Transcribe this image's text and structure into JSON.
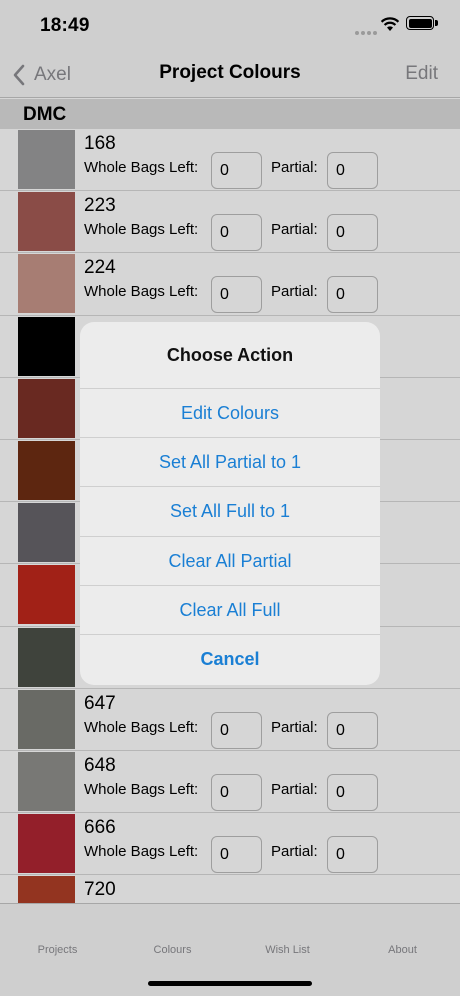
{
  "status": {
    "time": "18:49"
  },
  "nav": {
    "back_label": "Axel",
    "title": "Project Colours",
    "edit_label": "Edit"
  },
  "section": {
    "title": "DMC"
  },
  "labels": {
    "whole": "Whole Bags Left:",
    "partial": "Partial:"
  },
  "rows": [
    {
      "code": "168",
      "color": "#9c9c9e",
      "whole": "0",
      "partial": "0"
    },
    {
      "code": "223",
      "color": "#a55b55",
      "whole": "0",
      "partial": "0"
    },
    {
      "code": "224",
      "color": "#c8968a",
      "whole": "0",
      "partial": "0"
    },
    {
      "code": "",
      "color": "#000000",
      "whole": "",
      "partial": ""
    },
    {
      "code": "",
      "color": "#7e3228",
      "whole": "",
      "partial": ""
    },
    {
      "code": "",
      "color": "#6f2e14",
      "whole": "",
      "partial": ""
    },
    {
      "code": "",
      "color": "#67656b",
      "whole": "",
      "partial": ""
    },
    {
      "code": "",
      "color": "#c0281c",
      "whole": "",
      "partial": ""
    },
    {
      "code": "",
      "color": "#4c5048",
      "whole": "",
      "partial": ""
    },
    {
      "code": "647",
      "color": "#7e7f79",
      "whole": "0",
      "partial": "0"
    },
    {
      "code": "648",
      "color": "#8f8f8c",
      "whole": "0",
      "partial": "0"
    },
    {
      "code": "666",
      "color": "#b02633",
      "whole": "0",
      "partial": "0"
    },
    {
      "code": "720",
      "color": "#b03e27",
      "whole": "",
      "partial": ""
    }
  ],
  "tabs": [
    "Projects",
    "Colours",
    "Wish List",
    "About"
  ],
  "action_sheet": {
    "title": "Choose Action",
    "buttons": [
      "Edit Colours",
      "Set All Partial to 1",
      "Set All Full to 1",
      "Clear All Partial",
      "Clear All Full"
    ],
    "cancel": "Cancel"
  }
}
